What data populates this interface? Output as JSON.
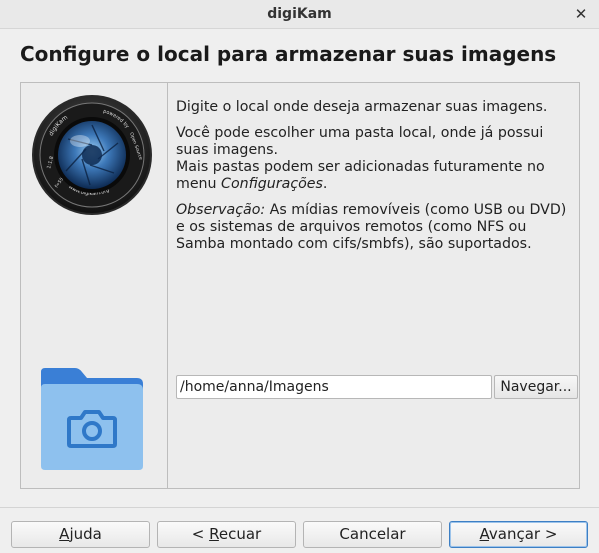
{
  "window": {
    "title": "digiKam",
    "close_glyph": "✕"
  },
  "page": {
    "heading": "Configure o local para armazenar suas imagens"
  },
  "description": {
    "intro": "Digite o local onde deseja armazenar suas imagens.",
    "local_folder_line1": "Você pode escolher uma pasta local, onde já possui",
    "local_folder_line2": "suas imagens.",
    "more_folders_prefix": "Mais pastas podem ser adicionadas futuramente no menu ",
    "more_folders_menu": "Configurações",
    "more_folders_suffix": ".",
    "note_label": "Observação:",
    "note_text": " As mídias removíveis (como USB ou DVD) e os sistemas de arquivos remotos (como NFS ou Samba montado com cifs/smbfs), são suportados."
  },
  "lens_ring_text": {
    "left": "1:1.8",
    "top": "digiKam",
    "top_right": "powered by",
    "right": "Open Source",
    "bottom": "www.digikam.org",
    "left_lower": "f=55mm"
  },
  "path": {
    "value": "/home/anna/Imagens"
  },
  "browse_label": "Navegar...",
  "buttons": {
    "help": "Ajuda",
    "help_mnemonic": "A",
    "back": "< Recuar",
    "back_mnemonic": "R",
    "cancel": "Cancelar",
    "next": "Avançar >",
    "next_mnemonic": "A"
  },
  "icons": {
    "close": "close-icon",
    "lens": "digikam-lens-icon",
    "folder": "folder-camera-icon"
  },
  "colors": {
    "folder_front": "#8ec1ee",
    "folder_back": "#3a7fd6",
    "lens_blue": "#3d78b8",
    "primary_border": "#3d7fc4"
  }
}
